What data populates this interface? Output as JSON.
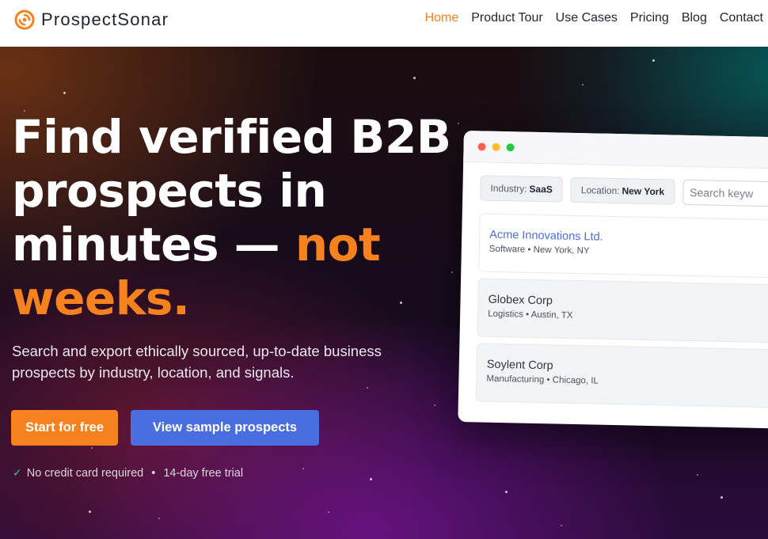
{
  "brand": {
    "name": "ProspectSonar",
    "accent": "#f5821f",
    "secondary": "#4a6ee0"
  },
  "nav": {
    "items": [
      {
        "label": "Home",
        "active": true
      },
      {
        "label": "Product Tour"
      },
      {
        "label": "Use Cases"
      },
      {
        "label": "Pricing"
      },
      {
        "label": "Blog"
      },
      {
        "label": "Contact"
      }
    ]
  },
  "hero": {
    "headline_line1": "Find verified B2B",
    "headline_line2": "prospects in",
    "headline_line3a": "minutes — ",
    "headline_highlight_a": "not",
    "headline_highlight_b": "weeks.",
    "subheadline": "Search and export ethically sourced, up-to-date business prospects by industry, location, and signals.",
    "primary_cta": "Start for free",
    "secondary_cta": "View sample prospects",
    "trust_1": "No credit card required",
    "trust_sep": "•",
    "trust_2": "14-day free trial"
  },
  "app_preview": {
    "filters": [
      {
        "key": "Industry:",
        "value": "SaaS"
      },
      {
        "key": "Location:",
        "value": "New York"
      }
    ],
    "search_placeholder": "Search keyw",
    "results": [
      {
        "name": "Acme Innovations Ltd.",
        "meta": "Software • New York, NY"
      },
      {
        "name": "Globex Corp",
        "meta": "Logistics • Austin, TX"
      },
      {
        "name": "Soylent Corp",
        "meta": "Manufacturing • Chicago, IL"
      }
    ]
  }
}
